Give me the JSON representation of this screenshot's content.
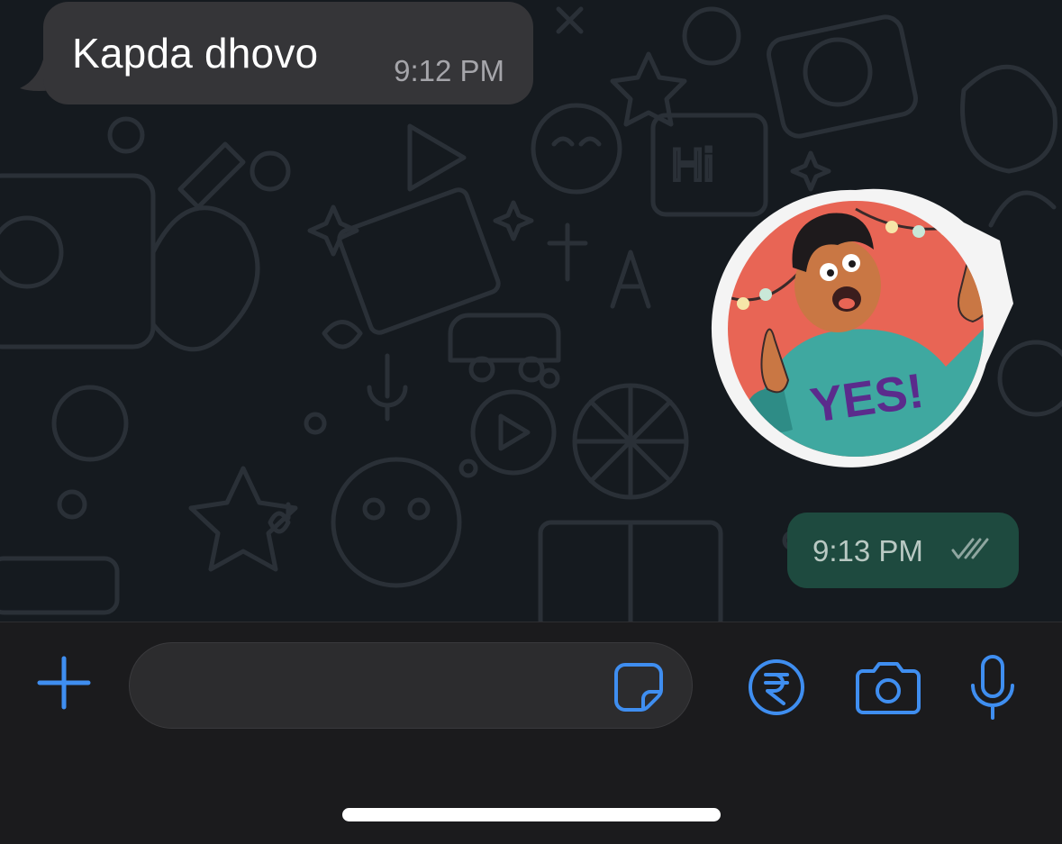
{
  "messages": [
    {
      "direction": "incoming",
      "text": "Kapda dhovo",
      "time": "9:12 PM"
    },
    {
      "direction": "outgoing",
      "type": "sticker",
      "sticker_text": "YES!",
      "time": "9:13 PM",
      "status": "read"
    }
  ],
  "composer": {
    "input_value": "",
    "input_placeholder": ""
  },
  "icons": {
    "attach": "plus-icon",
    "sticker": "sticker-icon",
    "payment": "rupee-icon",
    "camera": "camera-icon",
    "voice": "microphone-icon"
  },
  "colors": {
    "accent": "#3f8ef0",
    "incoming_bubble": "#353538",
    "outgoing_bubble": "#1e4a3f",
    "chat_background": "#151a1f",
    "read_ticks": "#8fa6a0"
  }
}
